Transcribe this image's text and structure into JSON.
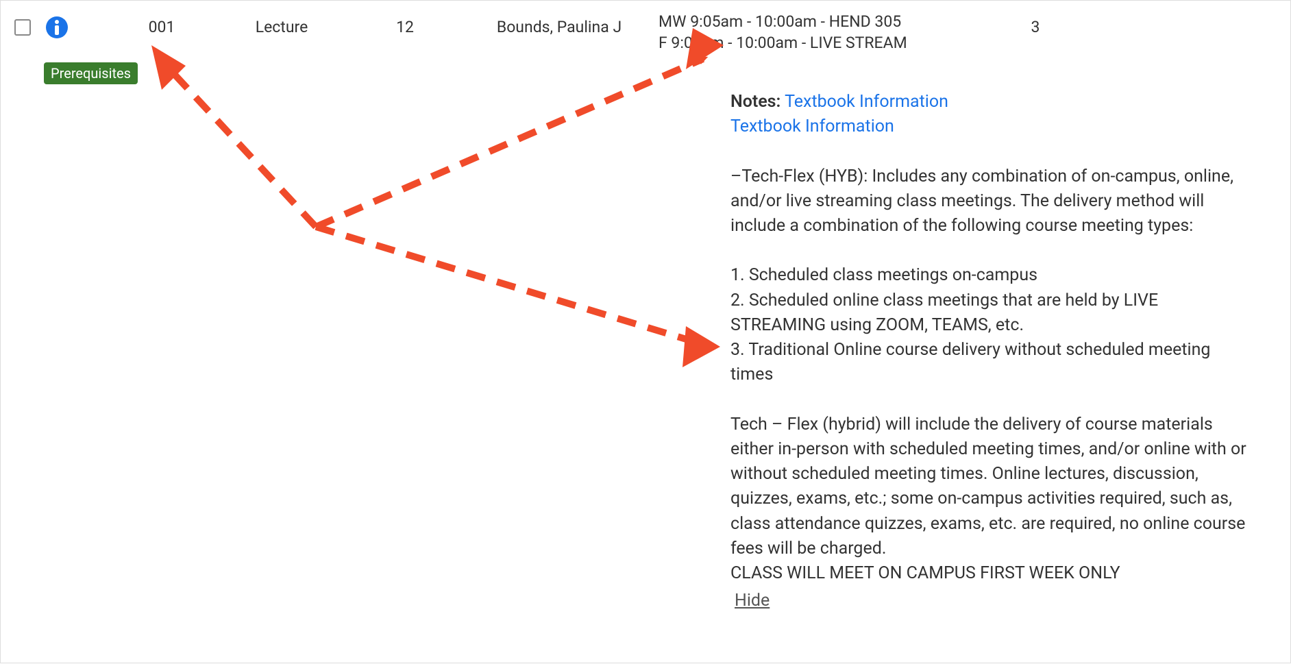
{
  "row": {
    "section": "001",
    "type": "Lecture",
    "seats": "12",
    "instructor": "Bounds, Paulina J",
    "meeting_line1": "MW 9:05am - 10:00am - HEND 305",
    "meeting_line2": "F 9:05am - 10:00am - LIVE STREAM",
    "credits": "3"
  },
  "prereq_badge": "Prerequisites",
  "notes": {
    "label": "Notes:",
    "link1": "Textbook Information",
    "link2": "Textbook Information",
    "para1": "–Tech-Flex (HYB): Includes any combination of on-campus, online, and/or live streaming class meetings. The delivery method will include a combination of the following course meeting types:",
    "item1": "1. Scheduled class meetings on-campus",
    "item2": "2. Scheduled online class meetings that are held by LIVE STREAMING using ZOOM, TEAMS, etc.",
    "item3": "3. Traditional Online course delivery without scheduled meeting times",
    "para2": "Tech – Flex (hybrid) will include the delivery of course materials either in-person with scheduled meeting times, and/or online with or without scheduled meeting times. Online lectures, discussion, quizzes, exams, etc.; some on-campus activities required, such as, class attendance quizzes, exams, etc. are required, no online course fees will be charged.",
    "para3": "CLASS WILL MEET ON CAMPUS FIRST WEEK ONLY",
    "hide": "Hide"
  }
}
